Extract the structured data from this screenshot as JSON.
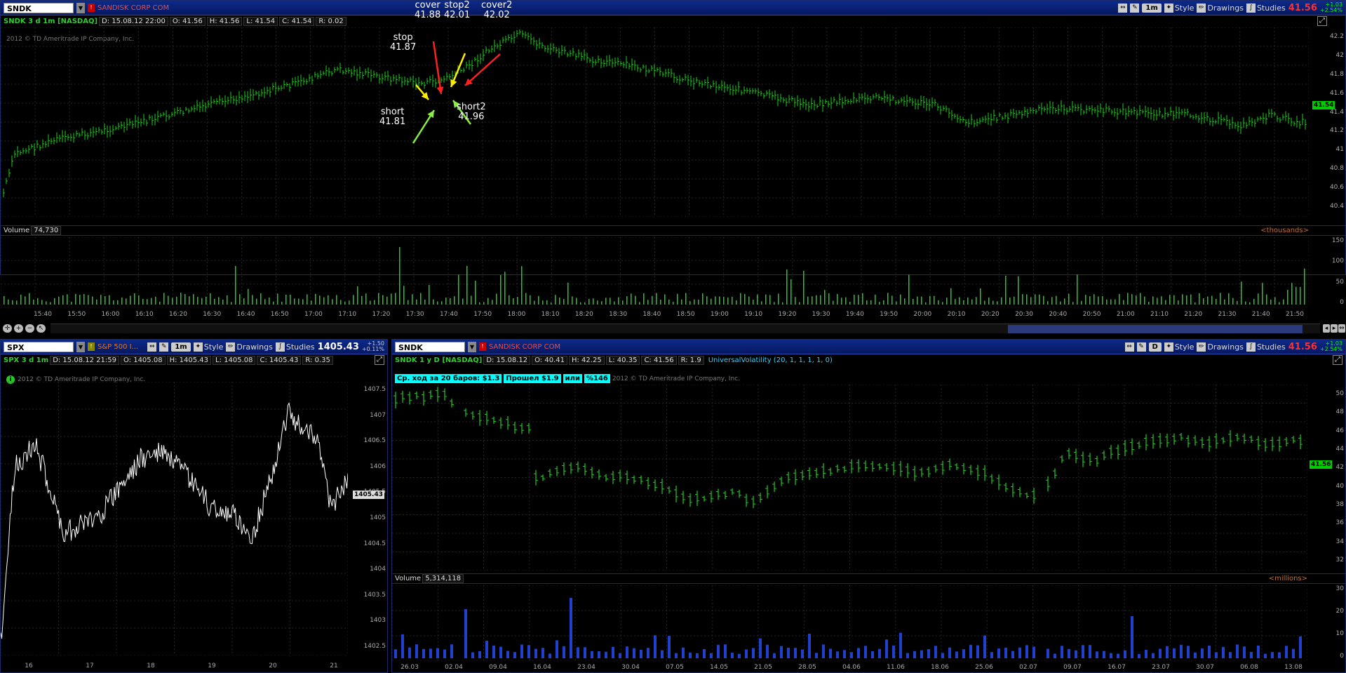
{
  "main_chart": {
    "symbol": "SNDK",
    "company": "SANDISK CORP COM",
    "aggregation": "1m",
    "style_label": "Style",
    "drawings_label": "Drawings",
    "studies_label": "Studies",
    "last_price": "41.56",
    "change": "+1.03",
    "change_pct": "+2.54%",
    "chart_title": "SNDK 3 d 1m [NASDAQ]",
    "date": "D: 15.08.12 22:00",
    "open": "O: 41.56",
    "high": "H: 41.56",
    "low": "L: 41.54",
    "close": "C: 41.54",
    "range": "R: 0.02",
    "copyright": "2012 © TD Ameritrade IP Company, Inc.",
    "current_price_label": "41.54",
    "price_ticks": [
      "42.2",
      "42",
      "41.8",
      "41.6",
      "41.4",
      "41.2",
      "41",
      "40.8",
      "40.6",
      "40.4"
    ],
    "volume_label": "Volume",
    "volume_value": "74,730",
    "volume_units": "<thousands>",
    "volume_ticks": [
      "150",
      "100",
      "50",
      "0"
    ],
    "time_ticks": [
      "15:40",
      "15:50",
      "16:00",
      "16:10",
      "16:20",
      "16:30",
      "16:40",
      "16:50",
      "17:00",
      "17:10",
      "17:20",
      "17:30",
      "17:40",
      "17:50",
      "18:00",
      "18:10",
      "18:20",
      "18:30",
      "18:40",
      "18:50",
      "19:00",
      "19:10",
      "19:20",
      "19:30",
      "19:40",
      "19:50",
      "20:00",
      "20:10",
      "20:20",
      "20:30",
      "20:40",
      "20:50",
      "21:00",
      "21:10",
      "21:20",
      "21:30",
      "21:40",
      "21:50"
    ],
    "annotations": [
      {
        "label": "cover",
        "value": "41.88"
      },
      {
        "label": "stop2",
        "value": "42.01"
      },
      {
        "label": "cover2",
        "value": "42.02"
      },
      {
        "label": "stop",
        "value": "41.87"
      },
      {
        "label": "short",
        "value": "41.81"
      },
      {
        "label": "short2",
        "value": "41.96"
      }
    ]
  },
  "spx_chart": {
    "symbol": "SPX",
    "company": "S&P 500 I...",
    "aggregation": "1m",
    "style_label": "Style",
    "drawings_label": "Drawings",
    "studies_label": "Studies",
    "last_price": "1405.43",
    "change": "+1.50",
    "change_pct": "+0.11%",
    "chart_title": "SPX 3 d 1m",
    "date": "D: 15.08.12 21:59",
    "open": "O: 1405.08",
    "high": "H: 1405.43",
    "low": "L: 1405.08",
    "close": "C: 1405.43",
    "range": "R: 0.35",
    "copyright": "2012 © TD Ameritrade IP Company, Inc.",
    "current_price_label": "1405.43",
    "price_ticks": [
      "1407.5",
      "1407",
      "1406.5",
      "1406",
      "1405.5",
      "1405",
      "1404.5",
      "1404",
      "1403.5",
      "1403",
      "1402.5"
    ],
    "date_ticks": [
      "16",
      "17",
      "18",
      "19",
      "20",
      "21"
    ]
  },
  "daily_chart": {
    "symbol": "SNDK",
    "company": "SANDISK CORP COM",
    "aggregation": "D",
    "style_label": "Style",
    "drawings_label": "Drawings",
    "studies_label": "Studies",
    "last_price": "41.56",
    "change": "+1.03",
    "change_pct": "+2.54%",
    "chart_title": "SNDK 1 y D [NASDAQ]",
    "date": "D: 15.08.12",
    "open": "O: 40.41",
    "high": "H: 42.25",
    "low": "L: 40.35",
    "close": "C: 41.56",
    "range": "R: 1.9",
    "study": "UniversalVolatility (20, 1, 1, 1, 1, 0)",
    "badges": [
      "Ср. ход за 20 баров: $1.3",
      "Прошел $1.9",
      "или",
      "%146"
    ],
    "copyright": "2012 © TD Ameritrade IP Company, Inc.",
    "current_price_label": "41.56",
    "price_ticks": [
      "50",
      "48",
      "46",
      "44",
      "42",
      "40",
      "38",
      "36",
      "34",
      "32"
    ],
    "volume_label": "Volume",
    "volume_value": "5,314,118",
    "volume_units": "<millions>",
    "volume_ticks": [
      "30",
      "20",
      "10",
      "0"
    ],
    "date_ticks": [
      "26.03",
      "02.04",
      "09.04",
      "16.04",
      "23.04",
      "30.04",
      "07.05",
      "14.05",
      "21.05",
      "28.05",
      "04.06",
      "11.06",
      "18.06",
      "25.06",
      "02.07",
      "09.07",
      "16.07",
      "23.07",
      "30.07",
      "06.08",
      "13.08"
    ]
  },
  "colors": {
    "up_bar": "#22cc22",
    "spx_line": "#ffffff",
    "daily_volume": "#2040d0",
    "toolbar_bg": "#0d2a8a",
    "last_price_red": "#ff3030"
  }
}
